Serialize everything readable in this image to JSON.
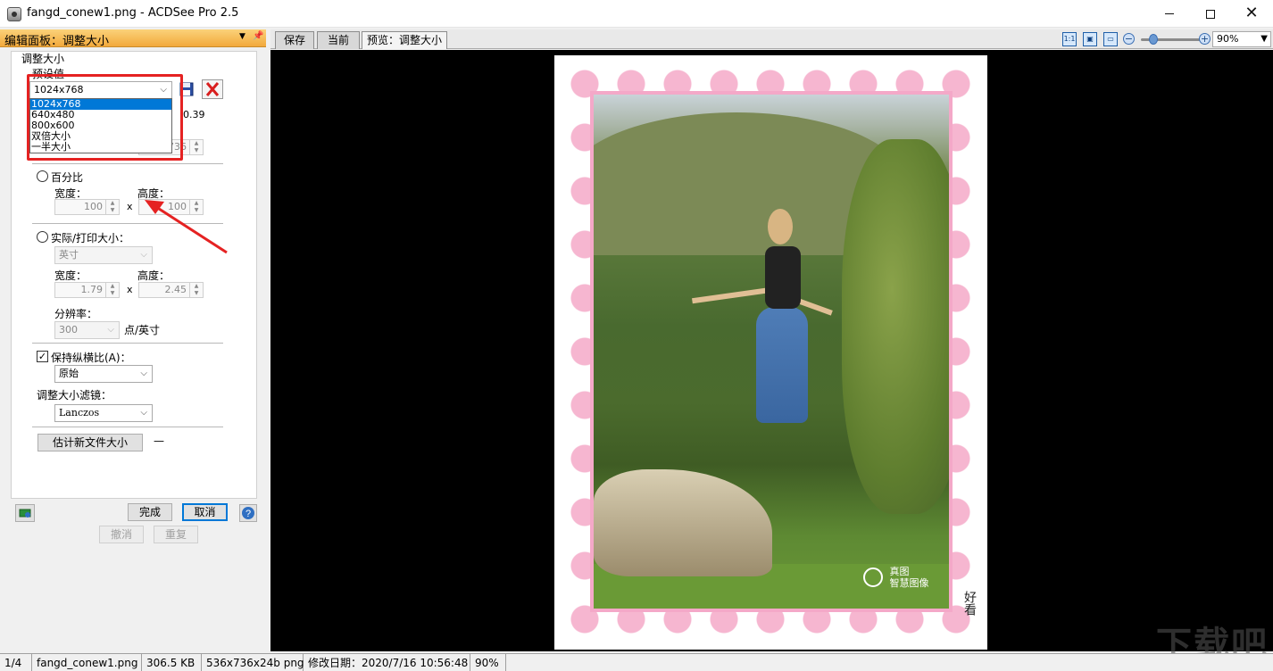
{
  "window": {
    "title": "fangd_conew1.png - ACDSee Pro 2.5"
  },
  "panel": {
    "title": "编辑面板：调整大小",
    "group_title": "调整大小",
    "preset_label": "预设值",
    "preset_selected": "1024x768",
    "preset_options": [
      "1024x768",
      "640x480",
      "800x600",
      "双倍大小",
      "一半大小"
    ],
    "partial_value": "0.39",
    "partial_spin_value": "736",
    "percent_label": "百分比",
    "width_label": "宽度：",
    "height_label": "高度：",
    "percent_width": "100",
    "percent_height": "100",
    "times": "x",
    "actual_label": "实际/打印大小：",
    "unit_selected": "英寸",
    "actual_width_label": "宽度：",
    "actual_height_label": "高度：",
    "actual_width": "1.79",
    "actual_height": "2.45",
    "resolution_label": "分辨率：",
    "resolution_value": "300",
    "resolution_unit": "点/英寸",
    "keep_ratio_label": "保持纵横比(A)：",
    "ratio_selected": "原始",
    "filter_label": "调整大小滤镜：",
    "filter_selected": "Lanczos",
    "estimate_button": "估计新文件大小",
    "estimate_value": "—",
    "done_button": "完成",
    "cancel_button": "取消",
    "undo_button": "撤消",
    "redo_button": "重复"
  },
  "tabs": [
    {
      "label": "保存"
    },
    {
      "label": "当前"
    },
    {
      "label": "预览：调整大小"
    }
  ],
  "toolbar": {
    "zoom_value": "90%",
    "actual_size_icon_label": "1:1"
  },
  "image": {
    "watermark_line1": "真图",
    "watermark_line2": "智慧图像",
    "vertical_text": "好看"
  },
  "status": {
    "index": "1/4",
    "filename": "fangd_conew1.png",
    "filesize": "306.5 KB",
    "dimensions": "536x736x24b png",
    "modified": "修改日期：2020/7/16 10:56:48",
    "zoom": "90%"
  },
  "site_logo": "下载吧",
  "colors": {
    "panel_header": "#f2a93b",
    "highlight": "#0078d7",
    "annotation_red": "#e52222",
    "frame_pink": "#f4a8c8"
  }
}
